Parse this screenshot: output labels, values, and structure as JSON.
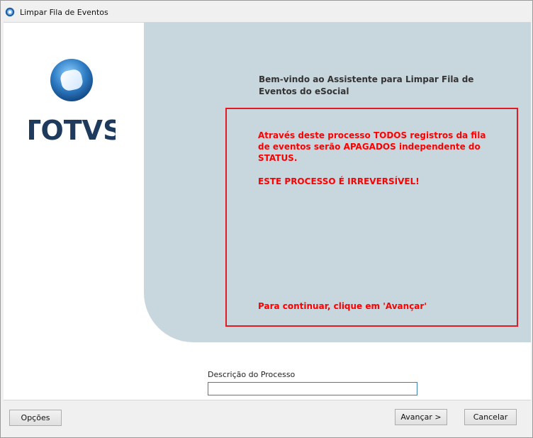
{
  "window": {
    "title": "Limpar Fila de Eventos",
    "icon": "app-globe-icon"
  },
  "logo": {
    "text": "TOTVS",
    "colors": {
      "brand": "#1e3a5c",
      "ring": "#2b6fb6"
    }
  },
  "wizard": {
    "welcome": "Bem-vindo ao Assistente para Limpar Fila de Eventos do eSocial",
    "warning_line1": "Através deste processo TODOS registros da fila de eventos serão APAGADOS independente do STATUS.",
    "warning_line2": "ESTE PROCESSO É IRREVERSÍVEL!",
    "continue_hint": "Para continuar, clique em 'Avançar'",
    "warning_color": "#ff0000"
  },
  "form": {
    "description_label": "Descrição do Processo",
    "description_value": ""
  },
  "buttons": {
    "options": "Opções",
    "next": "Avançar >",
    "cancel": "Cancelar"
  }
}
